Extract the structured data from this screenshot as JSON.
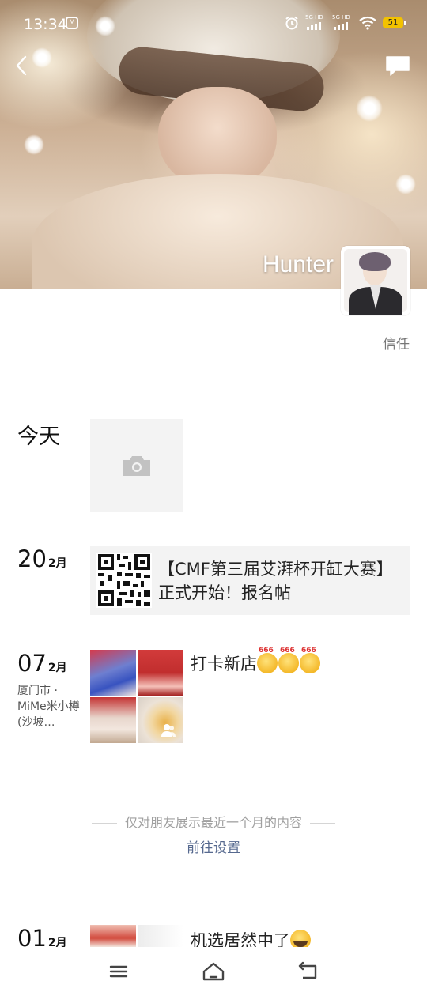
{
  "status_bar": {
    "time": "13:34",
    "app_icon_label": "M",
    "network_1": "5G HD",
    "network_2": "5G HD",
    "battery": "51",
    "icons": [
      "alarm-icon",
      "signal-icon",
      "signal-icon",
      "wifi-icon",
      "battery-icon"
    ]
  },
  "header": {
    "back_icon": "chevron-left-icon",
    "message_icon": "chat-bubble-icon"
  },
  "profile": {
    "name": "Hunter",
    "signature": "信任"
  },
  "timeline": [
    {
      "date_label": "今天",
      "type": "camera-placeholder",
      "icon": "camera-icon"
    },
    {
      "day": "20",
      "month": "2月",
      "type": "shared-link",
      "thumbnail": "qr-code",
      "text": "【CMF第三届艾湃杯开缸大赛】正式开始！报名帖"
    },
    {
      "day": "07",
      "month": "2月",
      "location": "厦门市 · MiMe米小樽(沙坡…",
      "type": "photos",
      "photo_count": 4,
      "text": "打卡新店",
      "emoji": "666-emoji",
      "emoji_count": 3
    }
  ],
  "privacy_notice": "仅对朋友展示最近一个月的内容",
  "settings_link": "前往设置",
  "partial_post": {
    "day": "01",
    "month": "2月",
    "text": "机选居然中了",
    "emoji": "laughing-tears-emoji"
  },
  "nav_bar": {
    "icons": [
      "menu-icon",
      "home-icon",
      "back-icon"
    ]
  },
  "colors": {
    "link": "#56698f",
    "card_bg": "#f3f3f3",
    "muted_text": "#a0a0a0",
    "battery": "#f2c200"
  }
}
